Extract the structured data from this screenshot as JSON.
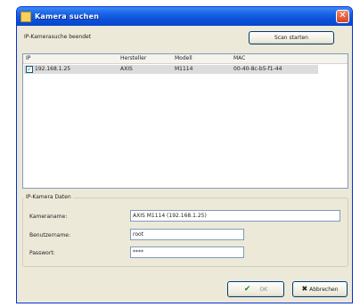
{
  "window": {
    "title": "Kamera suchen"
  },
  "search": {
    "status_label": "IP-Kamerasuche beendet",
    "start_button_label": "Scan starten"
  },
  "list": {
    "columns": [
      "IP",
      "Hersteller",
      "Modell",
      "MAC"
    ],
    "rows": [
      {
        "checked": true,
        "ip": "192.168.1.25",
        "manufacturer": "AXIS",
        "model": "M1114",
        "mac": "00-40-8c-b5-f1-44"
      }
    ]
  },
  "camera_data": {
    "group_title": "IP-Kamera Daten",
    "name_label": "Kameraname:",
    "name_value": "AXIS M1114 (192.168.1.25)",
    "user_label": "Benutzername:",
    "user_value": "root",
    "password_label": "Passwort:",
    "password_value": "****"
  },
  "footer": {
    "ok_label": "OK",
    "cancel_label": "Abbrechen"
  },
  "colors": {
    "titlebar": "#0a4fd8",
    "window_bg": "#ece9d8",
    "selected_row": "#dcdcdc",
    "check_green": "#21a121",
    "cancel_x": "#000000"
  }
}
